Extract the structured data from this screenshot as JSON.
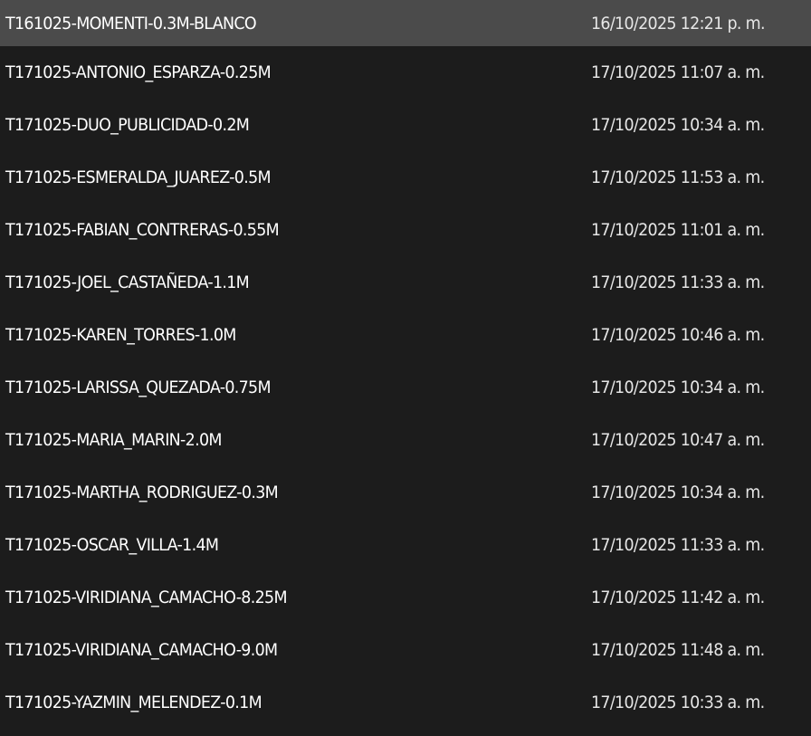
{
  "theme": {
    "background": "#1c1c1c",
    "selected_row": "#4b4b4b",
    "text": "#ffffff"
  },
  "files": [
    {
      "name": "T161025-MOMENTI-0.3M-BLANCO",
      "modified": "16/10/2025 12:21 p. m.",
      "selected": true
    },
    {
      "name": "T171025-ANTONIO_ESPARZA-0.25M",
      "modified": "17/10/2025 11:07 a. m.",
      "selected": false
    },
    {
      "name": "T171025-DUO_PUBLICIDAD-0.2M",
      "modified": "17/10/2025 10:34 a. m.",
      "selected": false
    },
    {
      "name": "T171025-ESMERALDA_JUAREZ-0.5M",
      "modified": "17/10/2025 11:53 a. m.",
      "selected": false
    },
    {
      "name": "T171025-FABIAN_CONTRERAS-0.55M",
      "modified": "17/10/2025 11:01 a. m.",
      "selected": false
    },
    {
      "name": "T171025-JOEL_CASTAÑEDA-1.1M",
      "modified": "17/10/2025 11:33 a. m.",
      "selected": false
    },
    {
      "name": "T171025-KAREN_TORRES-1.0M",
      "modified": "17/10/2025 10:46 a. m.",
      "selected": false
    },
    {
      "name": "T171025-LARISSA_QUEZADA-0.75M",
      "modified": "17/10/2025 10:34 a. m.",
      "selected": false
    },
    {
      "name": "T171025-MARIA_MARIN-2.0M",
      "modified": "17/10/2025 10:47 a. m.",
      "selected": false
    },
    {
      "name": "T171025-MARTHA_RODRIGUEZ-0.3M",
      "modified": "17/10/2025 10:34 a. m.",
      "selected": false
    },
    {
      "name": "T171025-OSCAR_VILLA-1.4M",
      "modified": "17/10/2025 11:33 a. m.",
      "selected": false
    },
    {
      "name": "T171025-VIRIDIANA_CAMACHO-8.25M",
      "modified": "17/10/2025 11:42 a. m.",
      "selected": false
    },
    {
      "name": "T171025-VIRIDIANA_CAMACHO-9.0M",
      "modified": "17/10/2025 11:48 a. m.",
      "selected": false
    },
    {
      "name": "T171025-YAZMIN_MELENDEZ-0.1M",
      "modified": "17/10/2025 10:33 a. m.",
      "selected": false
    }
  ]
}
